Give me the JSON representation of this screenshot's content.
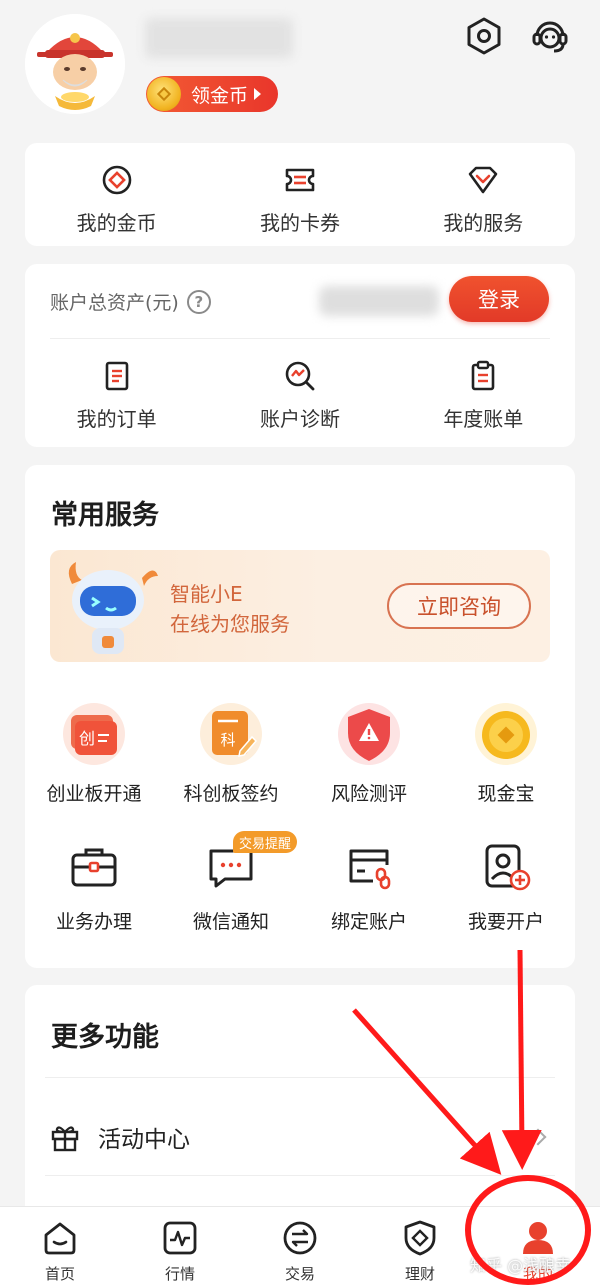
{
  "header": {
    "coin_pill_label": "领金币"
  },
  "quick_menu": [
    {
      "label": "我的金币",
      "icon": "coin-diamond-icon"
    },
    {
      "label": "我的卡券",
      "icon": "ticket-icon"
    },
    {
      "label": "我的服务",
      "icon": "gem-check-icon"
    }
  ],
  "account": {
    "assets_label": "账户总资产(元)",
    "help_glyph": "?",
    "login_label": "登录",
    "items": [
      {
        "label": "我的订单",
        "icon": "order-icon"
      },
      {
        "label": "账户诊断",
        "icon": "diagnosis-icon"
      },
      {
        "label": "年度账单",
        "icon": "bill-icon"
      }
    ]
  },
  "common_services": {
    "title": "常用服务",
    "banner": {
      "line1": "智能小E",
      "line2": "在线为您服务",
      "button": "立即咨询"
    },
    "row1": [
      {
        "label": "创业板开通",
        "icon_text": "创"
      },
      {
        "label": "科创板签约",
        "icon_text": "科"
      },
      {
        "label": "风险测评",
        "icon_text": "!"
      },
      {
        "label": "现金宝",
        "icon_text": ""
      }
    ],
    "row2": [
      {
        "label": "业务办理",
        "icon": "briefcase-icon"
      },
      {
        "label": "微信通知",
        "icon": "chat-icon"
      },
      {
        "label": "绑定账户",
        "icon": "card-link-icon"
      },
      {
        "label": "我要开户",
        "icon": "person-add-icon"
      }
    ],
    "badge": "交易提醒"
  },
  "more_features": {
    "title": "更多功能",
    "items": [
      {
        "label": "活动中心",
        "icon": "gift-icon"
      }
    ]
  },
  "bottom_nav": [
    {
      "label": "首页",
      "icon": "home-icon",
      "active": false
    },
    {
      "label": "行情",
      "icon": "chart-line-icon",
      "active": false
    },
    {
      "label": "交易",
      "icon": "exchange-icon",
      "active": false
    },
    {
      "label": "理财",
      "icon": "shield-diamond-icon",
      "active": false
    },
    {
      "label": "我的",
      "icon": "user-icon",
      "active": true
    }
  ],
  "watermark": "知乎 @浅酿幸",
  "colors": {
    "accent": "#e8412d",
    "annotation": "#ff1a1a",
    "background": "#f4f4f4"
  }
}
